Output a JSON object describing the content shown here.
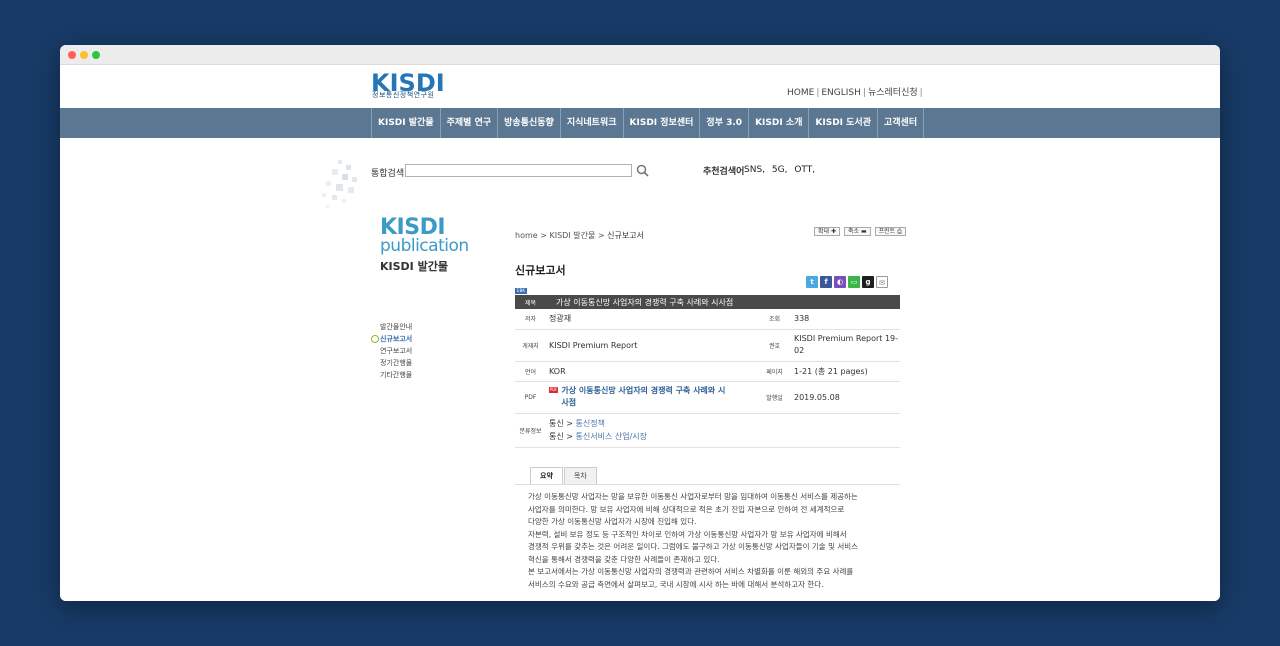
{
  "header": {
    "logo": "KISDI",
    "logo_sub": "정보통신정책연구원",
    "top_links": [
      "HOME",
      "ENGLISH",
      "뉴스레터신청"
    ]
  },
  "gnb": [
    "KISDI 발간물",
    "주제별 연구",
    "방송통신동향",
    "지식네트워크",
    "KISDI 정보센터",
    "정부 3.0",
    "KISDI 소개",
    "KISDI 도서관",
    "고객센터"
  ],
  "search": {
    "label": "통합검색",
    "value": "",
    "recommend_label": "추천검색어",
    "keywords": [
      "SNS,",
      "5G,",
      "OTT,"
    ]
  },
  "sidebar": {
    "title1": "KISDI",
    "title2": "publication",
    "title3": "KISDI 발간물",
    "items": [
      "발간물안내",
      "신규보고서",
      "연구보고서",
      "정기간행물",
      "기타간행물"
    ],
    "active_index": 1
  },
  "breadcrumb": {
    "home": "home",
    "sep": ">",
    "level1": "KISDI 발간물",
    "current": "신규보고서"
  },
  "util_buttons": [
    "확대",
    "축소",
    "프린트"
  ],
  "page_title": "신규보고서",
  "share_icons": [
    "twitter-icon",
    "facebook-icon",
    "naver-icon",
    "band-icon",
    "google-plus-icon",
    "email-icon"
  ],
  "badge": "EBK",
  "report": {
    "title_label": "제목",
    "title": "가상 이동통신망 사업자의 경쟁력 구축 사례와 시사점",
    "author_label": "저자",
    "author": "정광재",
    "views_label": "조회",
    "views": "338",
    "series_label": "게재지",
    "series": "KISDI Premium Report",
    "number_label": "권호",
    "number": "KISDI Premium Report 19-02",
    "lang_label": "언어",
    "lang": "KOR",
    "pages_label": "페이지",
    "pages": "1-21 (총 21 pages)",
    "pdf_label": "PDF",
    "pdf_icon": "PDF",
    "pdf_title": "가상 이동통신망 사업자의 경쟁력 구축 사례와 시사점",
    "date_label": "발행일",
    "date": "2019.05.08",
    "category_label": "분류정보",
    "categories": [
      {
        "parent": "통신",
        "sep": ">",
        "child": "통신정책"
      },
      {
        "parent": "통신",
        "sep": ">",
        "child": "통신서비스 산업/시장"
      }
    ]
  },
  "tabs": [
    "요약",
    "목차"
  ],
  "summary_lines": [
    "가상 이동통신망 사업자는 망을 보유한 이동통신 사업자로부터 망을 임대하여 이동통신 서비스를 제공하는",
    "사업자를 의미한다. 망 보유 사업자에 비해 상대적으로 적은 초기 진입 자본으로 인하여 전 세계적으로",
    "다양한 가상 이동통신망 사업자가 시장에 진입해 있다.",
    "자본력, 설비 보유 정도 등 구조적인 차이로 인하여 가상 이동통신망 사업자가 망 보유 사업자에 비해서",
    "경쟁적 우위를 갖추는 것은 어려운 일이다. 그럼에도 불구하고 가상 이동통신망 사업자들이 기술 및 서비스",
    "혁신을 통해서 경쟁력을 갖춘 다양한 사례들이 존재하고 있다.",
    "본 보고서에서는 가상 이동통신망 사업자의 경쟁력과 관련하여 서비스 차별화를 이룬 해외의 주요 사례를",
    "서비스의 수요와 공급 측면에서 살펴보고, 국내 시장에 시사 하는 바에 대해서 분석하고자 한다."
  ]
}
